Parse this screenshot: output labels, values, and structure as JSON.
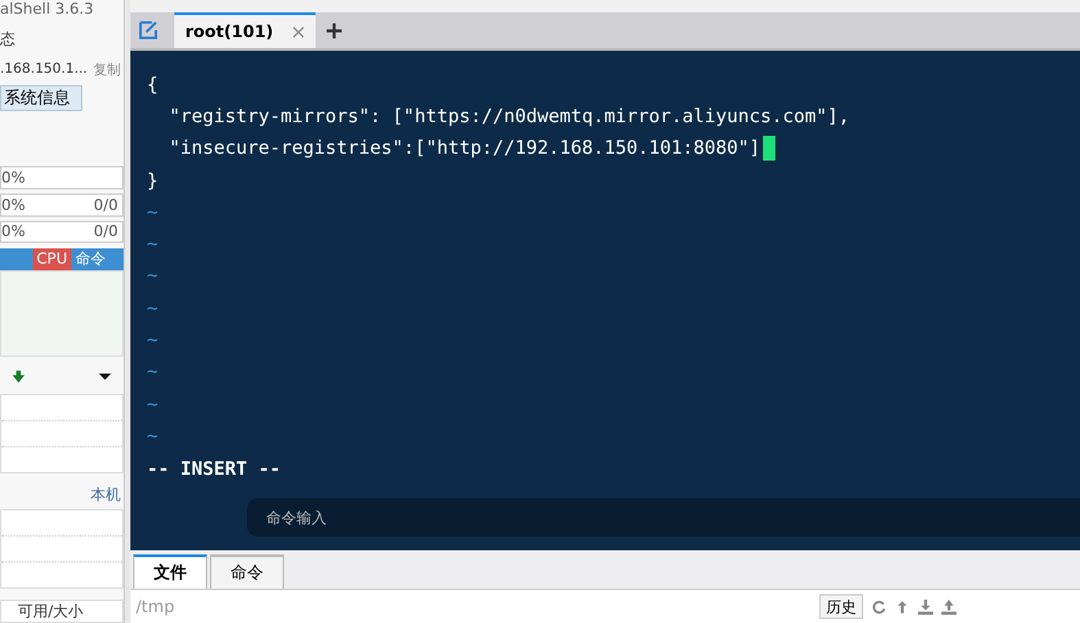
{
  "app_title": "alShell 3.6.3",
  "sidebar": {
    "status_label": "态",
    "host": ".168.150.1...",
    "copy_link": "复制",
    "sysinfo_button": "系统信息",
    "meters": [
      {
        "value": "0%"
      },
      {
        "value": "0%",
        "extra": "0/0"
      },
      {
        "value": "0%",
        "extra": "0/0"
      }
    ],
    "process_columns": [
      {
        "label": "CPU",
        "selected": true
      },
      {
        "label": "命令",
        "selected": false
      }
    ],
    "local_label": "本机",
    "disk_column": "可用/大小"
  },
  "tabs": [
    {
      "label": "root(101)",
      "selected": true
    }
  ],
  "terminal": {
    "lines": [
      {
        "text": "{",
        "cursor": false
      },
      {
        "text": "  \"registry-mirrors\": [\"https://n0dwemtq.mirror.aliyuncs.com\"],",
        "cursor": false
      },
      {
        "text": "  \"insecure-registries\":[\"http://192.168.150.101:8080\"]",
        "cursor": true
      },
      {
        "text": "}",
        "cursor": false
      },
      {
        "text": "~",
        "cursor": false
      },
      {
        "text": "~",
        "cursor": false
      },
      {
        "text": "~",
        "cursor": false
      },
      {
        "text": "~",
        "cursor": false
      },
      {
        "text": "~",
        "cursor": false
      },
      {
        "text": "~",
        "cursor": false
      },
      {
        "text": "~",
        "cursor": false
      },
      {
        "text": "~",
        "cursor": false
      }
    ],
    "mode": "-- INSERT --",
    "command_placeholder": "命令输入"
  },
  "bottom_tabs": [
    {
      "label": "文件",
      "selected": true
    },
    {
      "label": "命令",
      "selected": false
    }
  ],
  "path": "/tmp",
  "history_button": "历史"
}
